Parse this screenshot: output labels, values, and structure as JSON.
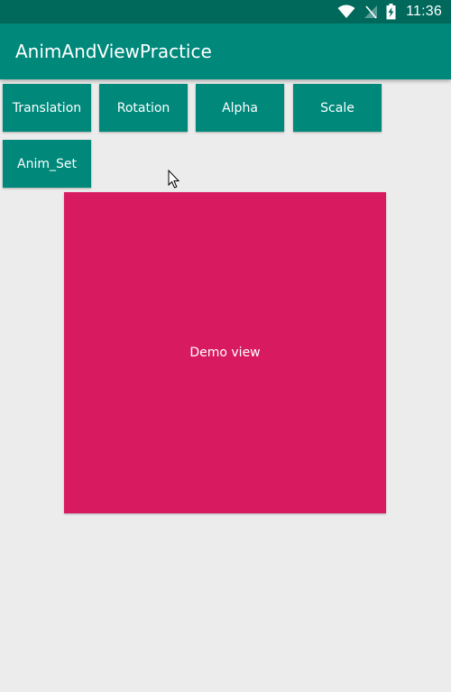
{
  "status_bar": {
    "time": "11:36",
    "icons": [
      "wifi-icon",
      "no-signal-icon",
      "battery-charging-icon"
    ],
    "color": "#00695c"
  },
  "app_bar": {
    "title": "AnimAndViewPractice",
    "color": "#00897b"
  },
  "buttons": {
    "translation": "Translation",
    "rotation": "Rotation",
    "alpha": "Alpha",
    "scale": "Scale",
    "anim_set": "Anim_Set",
    "color": "#00897b"
  },
  "demo_view": {
    "label": "Demo view",
    "color": "#d81b60"
  },
  "background_color": "#ececec"
}
